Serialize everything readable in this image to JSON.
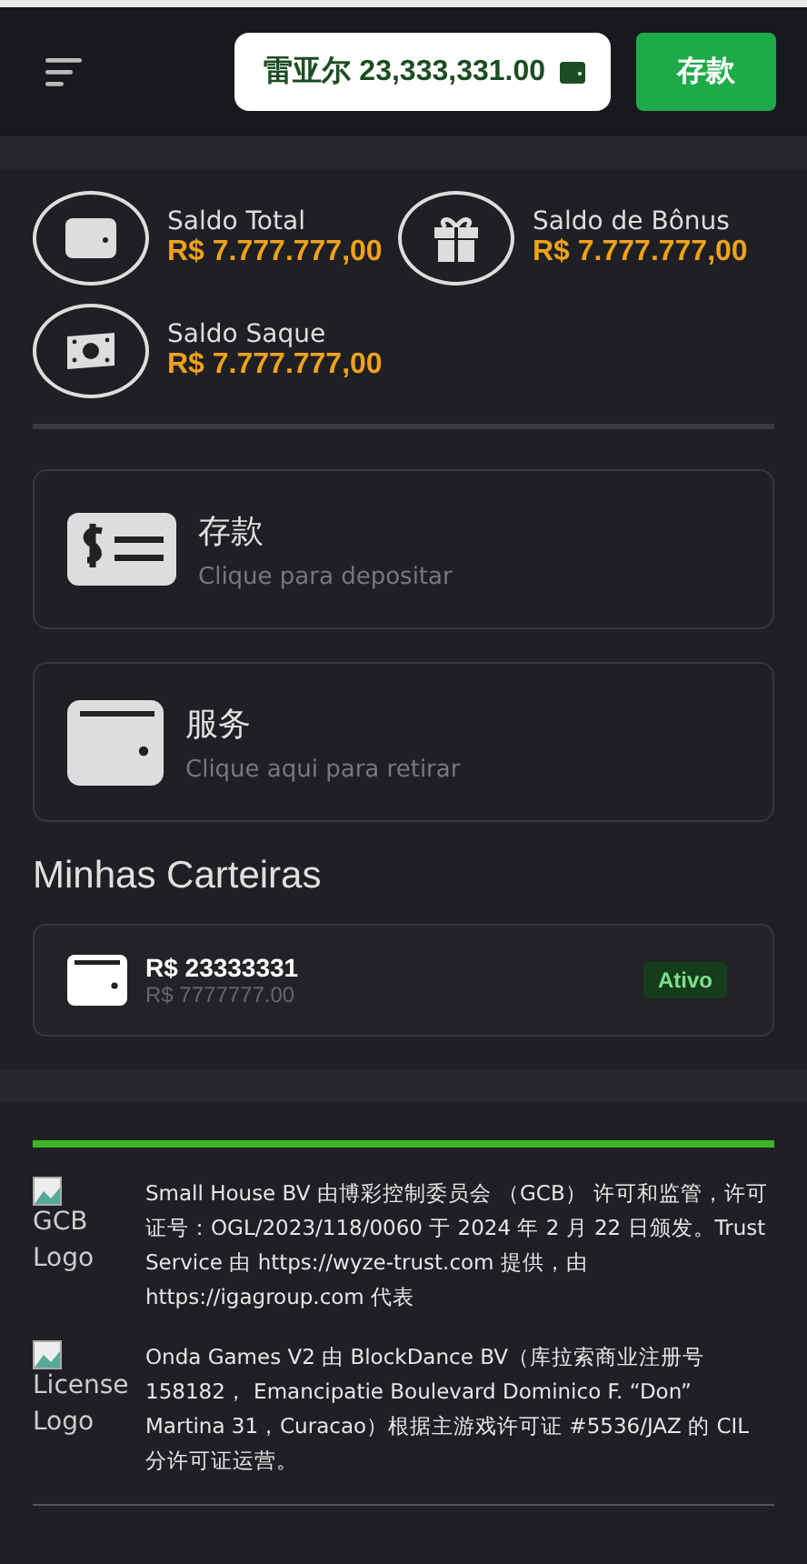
{
  "header": {
    "balance": "雷亚尔 23,333,331.00",
    "deposit_button": "存款"
  },
  "balances": [
    {
      "kind": "wallet",
      "label": "Saldo Total",
      "amount": "R$ 7.777.777,00"
    },
    {
      "kind": "gift",
      "label": "Saldo de Bônus",
      "amount": "R$ 7.777.777,00"
    },
    {
      "kind": "cash",
      "label": "Saldo Saque",
      "amount": "R$ 7.777.777,00"
    }
  ],
  "actions": [
    {
      "kind": "deposit",
      "title": "存款",
      "subtitle": "Clique para depositar"
    },
    {
      "kind": "withdraw",
      "title": "服务",
      "subtitle": "Clique aqui para retirar"
    }
  ],
  "wallets_title": "Minhas Carteiras",
  "wallets": [
    {
      "amount": "R$ 23333331",
      "sub_amount": "R$ 7777777.00",
      "status": "Ativo"
    }
  ],
  "licenses": [
    {
      "logo_alt": "GCB Logo",
      "text": "Small House BV 由博彩控制委员会 （GCB） 许可和监管，许可证号：OGL/2023/118/0060 于 2024 年 2 月 22 日颁发。Trust Service 由 https://wyze-trust.com 提供，由 https://igagroup.com 代表"
    },
    {
      "logo_alt": "License Logo",
      "text": "Onda Games V2 由 BlockDance BV（库拉索商业注册号 158182， Emancipatie Boulevard Dominico F. “Don” Martina 31，Curacao）根据主游戏许可证 #5536/JAZ 的 CIL 分许可证运营。"
    }
  ]
}
